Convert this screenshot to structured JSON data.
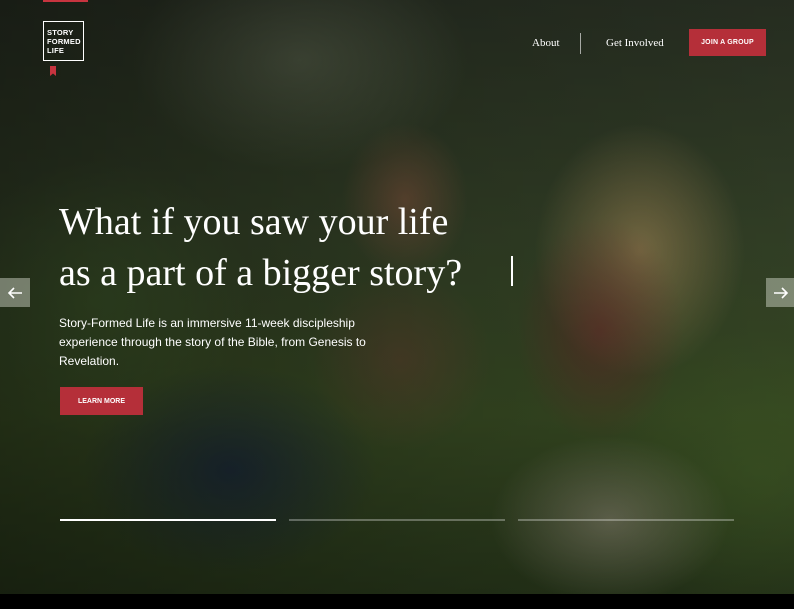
{
  "logo": {
    "lines": [
      "STORY",
      "FORMED",
      "LIFE"
    ]
  },
  "nav": {
    "about": "About",
    "get_involved": "Get Involved",
    "join_label": "JOIN A GROUP"
  },
  "hero": {
    "headline_line1": "What if you saw your life",
    "headline_line2": "as a part of a bigger story?",
    "description": "Story-Formed Life is an immersive 11-week discipleship experience through the story of the Bible, from Genesis to Revelation.",
    "cta_label": "LEARN MORE"
  },
  "slider": {
    "slide_count": 3,
    "active_slide": 1
  },
  "icons": {
    "prev": "arrow-left-icon",
    "next": "arrow-right-icon",
    "bookmark": "bookmark-icon"
  },
  "colors": {
    "accent": "#b52f39",
    "text": "#ffffff"
  }
}
